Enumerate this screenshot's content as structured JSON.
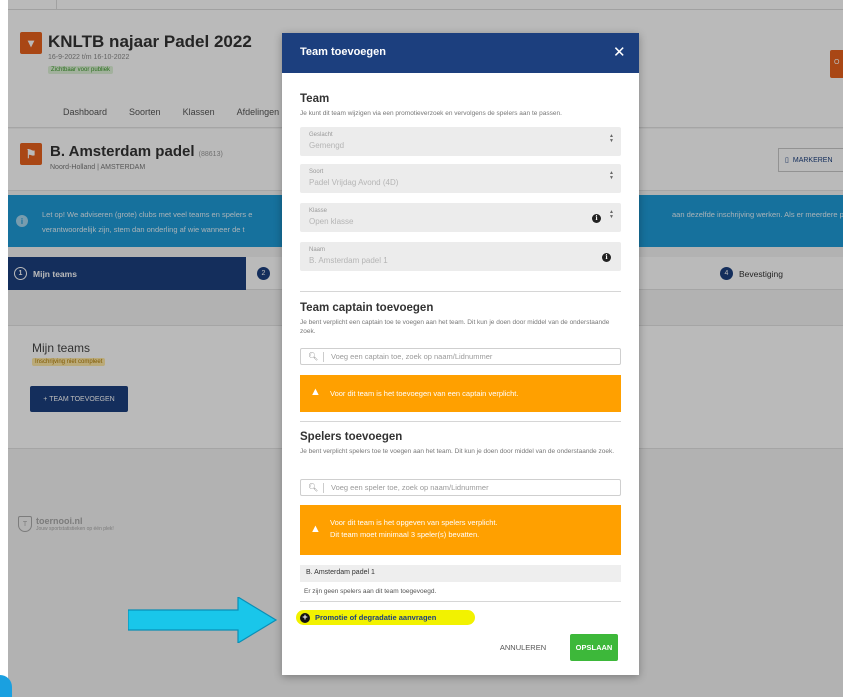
{
  "tournament": {
    "title": "KNLTB najaar Padel 2022",
    "dates": "16-9-2022 t/m 16-10-2022",
    "badge": "Zichtbaar voor publiek",
    "nav": [
      "Dashboard",
      "Soorten",
      "Klassen",
      "Afdelingen"
    ],
    "right_btn": "O"
  },
  "club": {
    "name": "B. Amsterdam padel",
    "code": "(88613)",
    "location": "Noord-Holland | AMSTERDAM",
    "mark_label": "MARKEREN"
  },
  "alert": {
    "line1": "Let op! We adviseren (grote) clubs met veel teams en spelers e",
    "line2": "verantwoordelijk zijn, stem dan onderling af wie wanneer de t",
    "right": "aan dezelfde inschrijving werken. Als er meerdere p"
  },
  "steps": {
    "step1_num": "1",
    "step1_label": "Mijn teams",
    "step2_num": "2",
    "step4_num": "4",
    "step4_label": "Bevestiging"
  },
  "my_teams": {
    "title": "Mijn teams",
    "badge": "Inschrijving niet compleet",
    "add_button": "+ TEAM TOEVOEGEN"
  },
  "footer_logo": {
    "name": "toernooi.nl",
    "tagline": "Jouw sportstatistieken op één plek!"
  },
  "modal": {
    "title": "Team toevoegen",
    "close": "✕",
    "team": {
      "heading": "Team",
      "description": "Je kunt dit team wijzigen via een promotieverzoek en vervolgens de spelers aan te passen.",
      "fields": [
        {
          "label": "Geslacht",
          "value": "Gemengd"
        },
        {
          "label": "Soort",
          "value": "Padel Vrijdag Avond (4D)"
        },
        {
          "label": "Klasse",
          "value": "Open klasse"
        },
        {
          "label": "Naam",
          "value": "B. Amsterdam padel 1"
        }
      ]
    },
    "captain": {
      "heading": "Team captain toevoegen",
      "description": "Je bent verplicht een captain toe te voegen aan het team. Dit kun je doen door middel van de onderstaande zoek.",
      "placeholder": "Voeg een captain toe, zoek op naam/Lidnummer",
      "warning": "Voor dit team is het toevoegen van een captain verplicht."
    },
    "players": {
      "heading": "Spelers toevoegen",
      "description": "Je bent verplicht spelers toe te voegen aan het team. Dit kun je doen door middel van de onderstaande zoek.",
      "placeholder": "Voeg een speler toe, zoek op naam/Lidnummer",
      "warning_line1": "Voor dit team is het opgeven van spelers verplicht.",
      "warning_line2": "Dit team moet minimaal 3 speler(s) bevatten.",
      "team_name": "B. Amsterdam padel 1",
      "no_players": "Er zijn geen spelers aan dit team toegevoegd."
    },
    "promotion_link": "Promotie of degradatie aanvragen",
    "cancel_label": "ANNULEREN",
    "save_label": "OPSLAAN"
  },
  "colors": {
    "primary": "#1c3f7e",
    "accent_orange": "#e8621d",
    "warning": "#ffa000",
    "info_blue": "#1f9bd8",
    "success": "#3db83a",
    "highlight": "#f2f200",
    "annotation_arrow": "#19c6ea"
  },
  "icons": [
    "tournament-icon",
    "club-flag-icon",
    "bookmark-icon",
    "info-icon",
    "close-icon",
    "search-icon",
    "warning-icon",
    "plus-circle-icon",
    "select-arrows-icon",
    "annotation-arrow"
  ]
}
